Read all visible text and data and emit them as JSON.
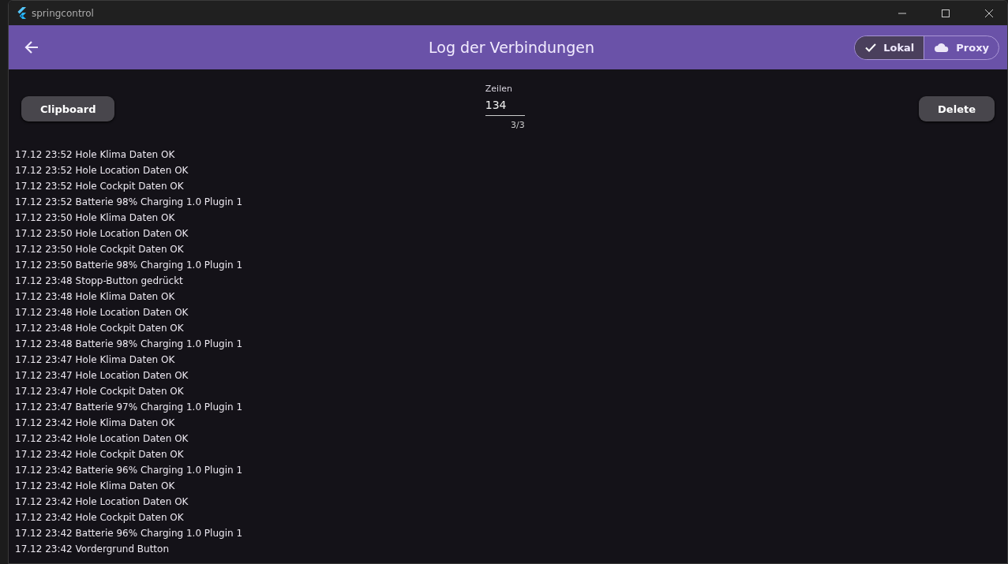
{
  "window": {
    "title": "springcontrol"
  },
  "app_bar": {
    "title": "Log der Verbindungen",
    "segments": [
      {
        "label": "Lokal",
        "kind": "check",
        "selected": true
      },
      {
        "label": "Proxy",
        "kind": "cloud",
        "selected": false
      }
    ]
  },
  "toolbar": {
    "clipboard_button": "Clipboard",
    "delete_button": "Delete",
    "lines_field": {
      "label": "Zeilen",
      "value": "134",
      "counter": "3/3"
    }
  },
  "log": [
    "17.12 23:52 Hole Klima Daten OK",
    "17.12 23:52 Hole Location Daten OK",
    "17.12 23:52 Hole Cockpit Daten OK",
    "17.12 23:52 Batterie 98% Charging 1.0 Plugin 1",
    "17.12 23:50 Hole Klima Daten OK",
    "17.12 23:50 Hole Location Daten OK",
    "17.12 23:50 Hole Cockpit Daten OK",
    "17.12 23:50 Batterie 98% Charging 1.0 Plugin 1",
    "17.12 23:48 Stopp-Button gedrückt",
    "17.12 23:48 Hole Klima Daten OK",
    "17.12 23:48 Hole Location Daten OK",
    "17.12 23:48 Hole Cockpit Daten OK",
    "17.12 23:48 Batterie 98% Charging 1.0 Plugin 1",
    "17.12 23:47 Hole Klima Daten OK",
    "17.12 23:47 Hole Location Daten OK",
    "17.12 23:47 Hole Cockpit Daten OK",
    "17.12 23:47 Batterie 97% Charging 1.0 Plugin 1",
    "17.12 23:42 Hole Klima Daten OK",
    "17.12 23:42 Hole Location Daten OK",
    "17.12 23:42 Hole Cockpit Daten OK",
    "17.12 23:42 Batterie 96% Charging 1.0 Plugin 1",
    "17.12 23:42 Hole Klima Daten OK",
    "17.12 23:42 Hole Location Daten OK",
    "17.12 23:42 Hole Cockpit Daten OK",
    "17.12 23:42 Batterie 96% Charging 1.0 Plugin 1",
    "17.12 23:42 Vordergrund Button"
  ]
}
